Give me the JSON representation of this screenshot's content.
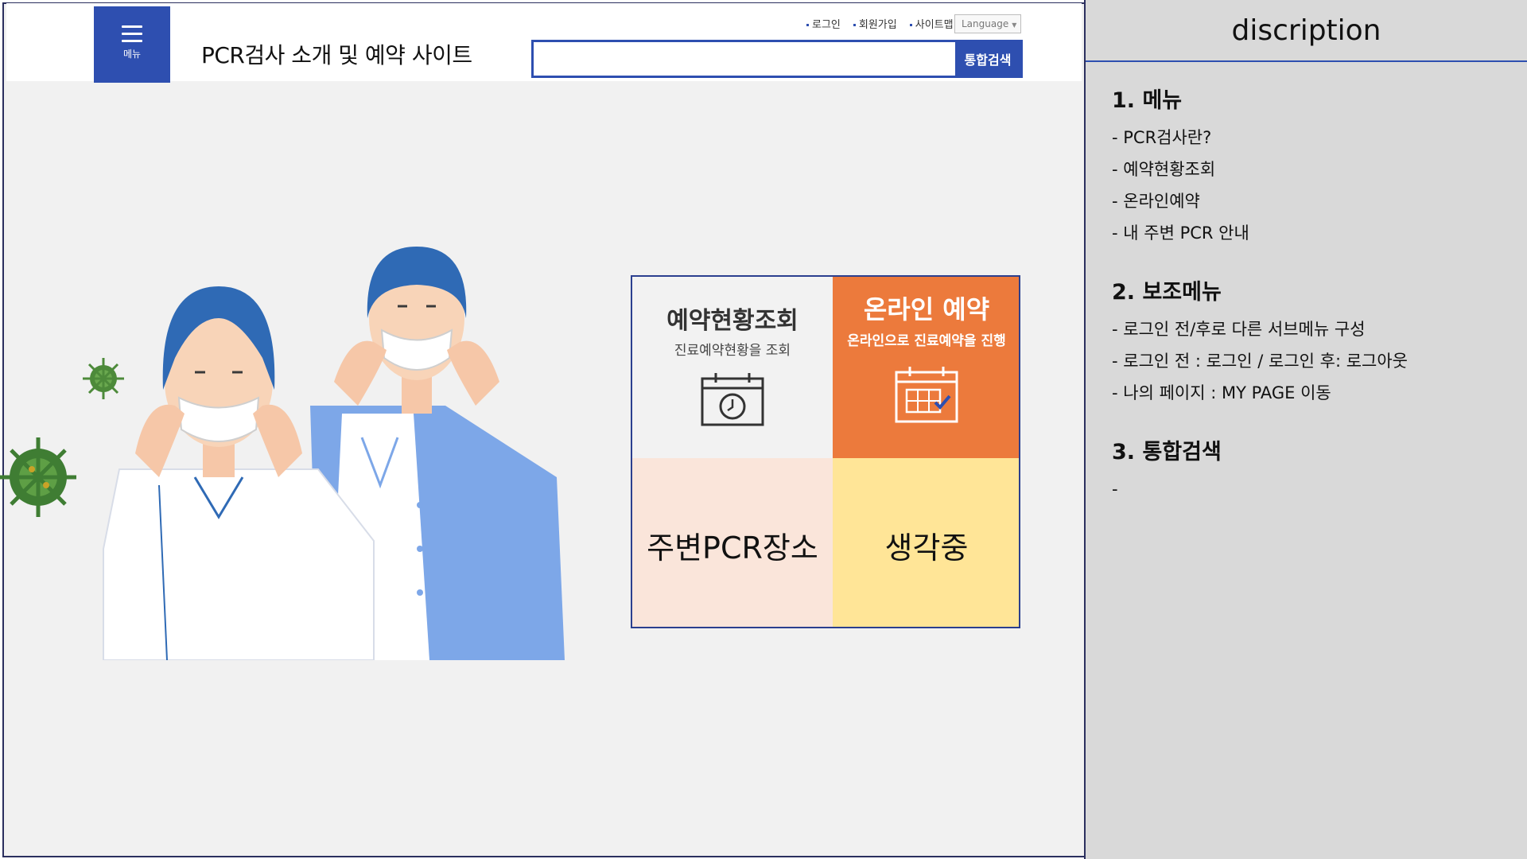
{
  "header": {
    "menu_label": "메뉴",
    "site_title": "PCR검사 소개 및 예약 사이트",
    "util_links": [
      "로그인",
      "회원가입",
      "사이트맵"
    ],
    "language_label": "Language",
    "search_value": "",
    "search_button": "통합검색"
  },
  "tiles": {
    "status": {
      "title": "예약현황조회",
      "subtitle": "진료예약현황을 조회"
    },
    "online": {
      "title": "온라인 예약",
      "subtitle": "온라인으로 진료예약을 진행"
    },
    "nearby": {
      "title": "주변PCR장소"
    },
    "thinking": {
      "title": "생각중"
    }
  },
  "description": {
    "title": "discription",
    "sections": [
      {
        "heading": "1. 메뉴",
        "items": [
          "- PCR검사란?",
          "- 예약현황조회",
          "- 온라인예약",
          "- 내 주변 PCR 안내"
        ]
      },
      {
        "heading": "2. 보조메뉴",
        "items": [
          "- 로그인 전/후로 다른 서브메뉴 구성",
          "- 로그인 전 : 로그인 / 로그인 후: 로그아웃",
          "- 나의 페이지 : MY PAGE 이동"
        ]
      },
      {
        "heading": "3. 통합검색",
        "items": [
          "-"
        ]
      }
    ]
  },
  "colors": {
    "brand_blue": "#2e4fb0",
    "online_orange": "#ec7a3c",
    "nearby_pink": "#fae5da",
    "thinking_yellow": "#ffe597",
    "panel_gray": "#d9d9d9"
  },
  "icons": [
    "hamburger-icon",
    "calendar-clock-icon",
    "calendar-check-icon",
    "virus-icon"
  ]
}
